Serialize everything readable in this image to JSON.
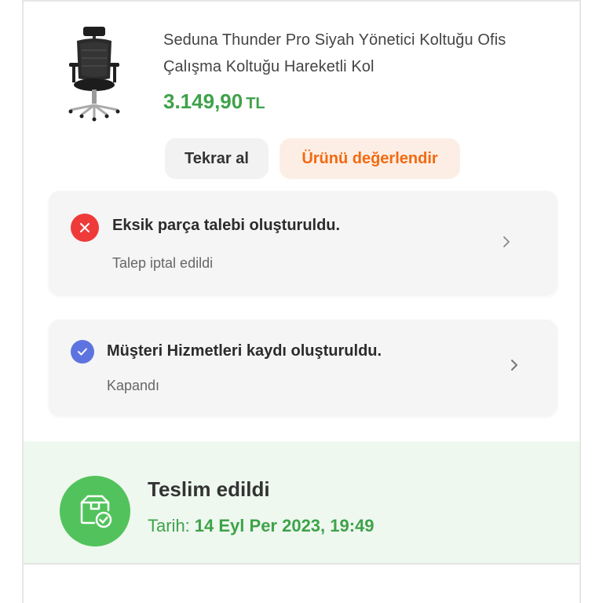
{
  "product": {
    "title_line1": "Seduna Thunder Pro Siyah Yönetici Koltuğu Ofis",
    "title_line2": "Çalışma Koltuğu Hareketli Kol",
    "price": "3.149,90",
    "currency": "TL",
    "image_icon": "office-chair-icon"
  },
  "actions": {
    "reorder_label": "Tekrar al",
    "review_label": "Ürünü değerlendir"
  },
  "requests": [
    {
      "status_icon": "close-icon",
      "title": "Eksik parça talebi oluşturuldu.",
      "subtitle": "Talep iptal edildi",
      "color": "#ef3a3a"
    },
    {
      "status_icon": "check-icon",
      "title": "Müşteri Hizmetleri kaydı oluşturuldu.",
      "subtitle": "Kapandı",
      "color": "#5d74e0"
    }
  ],
  "delivery": {
    "icon": "package-delivered-icon",
    "title": "Teslim edildi",
    "date_label": "Tarih:",
    "date_value": "14 Eyl Per 2023, 19:49"
  },
  "colors": {
    "price_green": "#3fa24a",
    "review_orange": "#f26a10",
    "delivered_bg": "#eef8ef"
  }
}
